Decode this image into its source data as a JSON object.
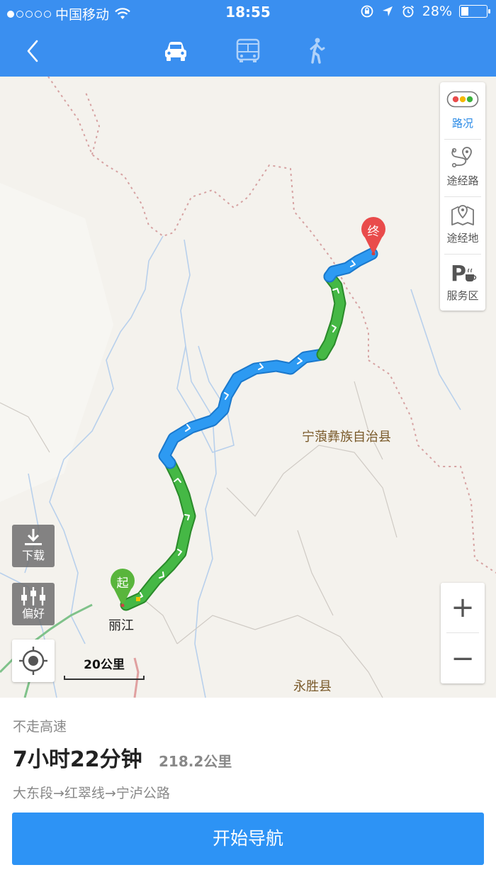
{
  "status_bar": {
    "carrier": "中国移动",
    "time": "18:55",
    "battery_percent": "28%",
    "battery_level": 0.28,
    "signal_bars_filled": 1,
    "signal_bars_total": 5
  },
  "nav": {
    "modes": [
      "car-icon",
      "bus-icon",
      "walk-icon"
    ],
    "active_mode": "car"
  },
  "map": {
    "side_panel": {
      "traffic_label": "路况",
      "waypoint_route_label": "途经路",
      "waypoint_place_label": "途经地",
      "service_area_label": "服务区"
    },
    "download_label": "下载",
    "preference_label": "偏好",
    "scale_label": "20公里",
    "start_marker": "起",
    "end_marker": "终",
    "place_labels": {
      "lijiang": "丽江",
      "ninglang": "宁蒗彝族自治县",
      "yongsheng": "永胜县"
    },
    "zoom_in": "+",
    "zoom_out": "−",
    "colors": {
      "route_smooth": "#3cb33c",
      "route_slow": "#2d9af2",
      "boundary": "#d9a6a6",
      "river": "#b8d0ec",
      "pin_start": "#59b53c",
      "pin_end": "#e94b4b"
    }
  },
  "route": {
    "preference": "不走高速",
    "duration": "7小时22分钟",
    "distance": "218.2公里",
    "roads": "大东段→红翠线→宁泸公路",
    "start_button": "开始导航"
  }
}
